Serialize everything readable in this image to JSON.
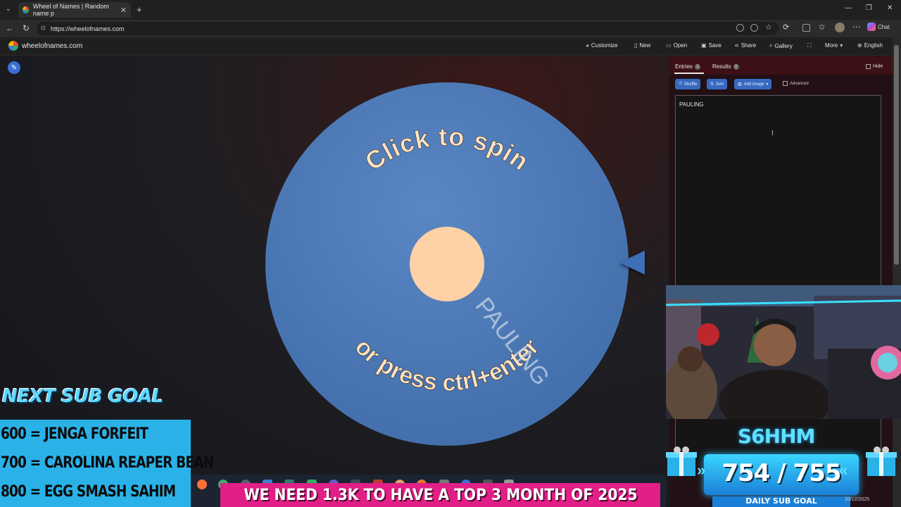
{
  "browser": {
    "tab_title": "Wheel of Names | Random name p",
    "tab_close": "✕",
    "new_tab": "+",
    "url": "https://wheelofnames.com",
    "chat_label": "Chat"
  },
  "site": {
    "logo_text": "wheelofnames.com",
    "nav": {
      "customize": "Customize",
      "new": "New",
      "open": "Open",
      "save": "Save",
      "share": "Share",
      "gallery": "Gallery",
      "more": "More",
      "language": "English"
    }
  },
  "wheel": {
    "top_text": "Click to spin",
    "bottom_text": "or press ctrl+enter",
    "entry_label": "PAULING",
    "wheel_color": "#4a79b9",
    "hub_color": "#ffd1a6"
  },
  "sidebar": {
    "tab_entries": "Entries",
    "entries_count": "1",
    "tab_results": "Results",
    "results_count": "0",
    "hide_label": "Hide",
    "shuffle_label": "Shuffle",
    "sort_label": "Sort",
    "add_image_label": "Add image",
    "advanced_label": "Advanced",
    "entries_text": "PAULING"
  },
  "overlay": {
    "sub_goal_title": "NEXT SUB GOAL",
    "goals": [
      "600 = JENGA FORFEIT",
      "700 = CAROLINA REAPER BEAN",
      "800 = EGG SMASH SAHIM"
    ],
    "ticker": "WE NEED 1.3K TO HAVE A TOP 3 MONTH OF 2025",
    "daily_name": "S6HHM",
    "daily_count": "754 / 755",
    "daily_progress": 0.9987,
    "daily_label": "DAILY SUB GOAL",
    "tray_date": "20/12/2025"
  },
  "colors": {
    "accent_blue": "#3769c0",
    "sidebar_red": "#3d1016",
    "ticker_pink": "#e11f86",
    "overlay_cyan": "#2ab2e8"
  }
}
